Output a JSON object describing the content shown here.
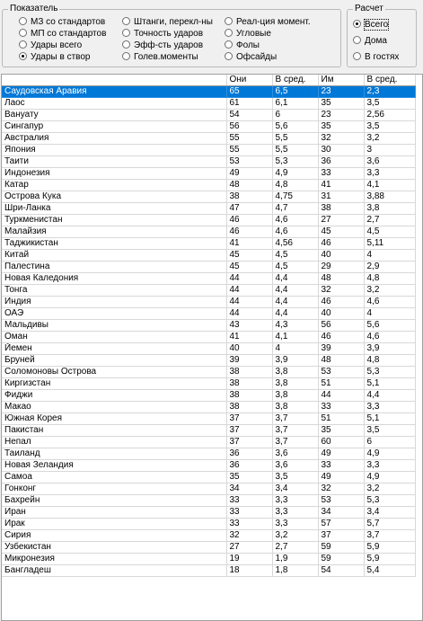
{
  "indicator": {
    "legend": "Показатель",
    "options": [
      {
        "label": "МЗ со стандартов",
        "checked": false
      },
      {
        "label": "МП со стандартов",
        "checked": false
      },
      {
        "label": "Удары всего",
        "checked": false
      },
      {
        "label": "Удары в створ",
        "checked": true
      },
      {
        "label": "Штанги, перекл-ны",
        "checked": false
      },
      {
        "label": "Точность ударов",
        "checked": false
      },
      {
        "label": "Эфф-сть ударов",
        "checked": false
      },
      {
        "label": "Голев.моменты",
        "checked": false
      },
      {
        "label": "Реал-ция момент.",
        "checked": false
      },
      {
        "label": "Угловые",
        "checked": false
      },
      {
        "label": "Фолы",
        "checked": false
      },
      {
        "label": "Офсайды",
        "checked": false
      }
    ]
  },
  "calc": {
    "legend": "Расчет",
    "options": [
      {
        "label": "Всего",
        "checked": true
      },
      {
        "label": "Дома",
        "checked": false
      },
      {
        "label": "В гостях",
        "checked": false
      }
    ]
  },
  "table": {
    "columns": [
      "",
      "Они",
      "В сред.",
      "Им",
      "В сред."
    ],
    "selected_row": 0,
    "rows": [
      [
        "Саудовская Аравия",
        "65",
        "6,5",
        "23",
        "2,3"
      ],
      [
        "Лаос",
        "61",
        "6,1",
        "35",
        "3,5"
      ],
      [
        "Вануату",
        "54",
        "6",
        "23",
        "2,56"
      ],
      [
        "Сингапур",
        "56",
        "5,6",
        "35",
        "3,5"
      ],
      [
        "Австралия",
        "55",
        "5,5",
        "32",
        "3,2"
      ],
      [
        "Япония",
        "55",
        "5,5",
        "30",
        "3"
      ],
      [
        "Таити",
        "53",
        "5,3",
        "36",
        "3,6"
      ],
      [
        "Индонезия",
        "49",
        "4,9",
        "33",
        "3,3"
      ],
      [
        "Катар",
        "48",
        "4,8",
        "41",
        "4,1"
      ],
      [
        "Острова Кука",
        "38",
        "4,75",
        "31",
        "3,88"
      ],
      [
        "Шри-Ланка",
        "47",
        "4,7",
        "38",
        "3,8"
      ],
      [
        "Туркменистан",
        "46",
        "4,6",
        "27",
        "2,7"
      ],
      [
        "Малайзия",
        "46",
        "4,6",
        "45",
        "4,5"
      ],
      [
        "Таджикистан",
        "41",
        "4,56",
        "46",
        "5,11"
      ],
      [
        "Китай",
        "45",
        "4,5",
        "40",
        "4"
      ],
      [
        "Палестина",
        "45",
        "4,5",
        "29",
        "2,9"
      ],
      [
        "Новая Каледония",
        "44",
        "4,4",
        "48",
        "4,8"
      ],
      [
        "Тонга",
        "44",
        "4,4",
        "32",
        "3,2"
      ],
      [
        "Индия",
        "44",
        "4,4",
        "46",
        "4,6"
      ],
      [
        "ОАЭ",
        "44",
        "4,4",
        "40",
        "4"
      ],
      [
        "Мальдивы",
        "43",
        "4,3",
        "56",
        "5,6"
      ],
      [
        "Оман",
        "41",
        "4,1",
        "46",
        "4,6"
      ],
      [
        "Йемен",
        "40",
        "4",
        "39",
        "3,9"
      ],
      [
        "Бруней",
        "39",
        "3,9",
        "48",
        "4,8"
      ],
      [
        "Соломоновы Острова",
        "38",
        "3,8",
        "53",
        "5,3"
      ],
      [
        "Киргизстан",
        "38",
        "3,8",
        "51",
        "5,1"
      ],
      [
        "Фиджи",
        "38",
        "3,8",
        "44",
        "4,4"
      ],
      [
        "Макао",
        "38",
        "3,8",
        "33",
        "3,3"
      ],
      [
        "Южная Корея",
        "37",
        "3,7",
        "51",
        "5,1"
      ],
      [
        "Пакистан",
        "37",
        "3,7",
        "35",
        "3,5"
      ],
      [
        "Непал",
        "37",
        "3,7",
        "60",
        "6"
      ],
      [
        "Таиланд",
        "36",
        "3,6",
        "49",
        "4,9"
      ],
      [
        "Новая Зеландия",
        "36",
        "3,6",
        "33",
        "3,3"
      ],
      [
        "Самоа",
        "35",
        "3,5",
        "49",
        "4,9"
      ],
      [
        "Гонконг",
        "34",
        "3,4",
        "32",
        "3,2"
      ],
      [
        "Бахрейн",
        "33",
        "3,3",
        "53",
        "5,3"
      ],
      [
        "Иран",
        "33",
        "3,3",
        "34",
        "3,4"
      ],
      [
        "Ирак",
        "33",
        "3,3",
        "57",
        "5,7"
      ],
      [
        "Сирия",
        "32",
        "3,2",
        "37",
        "3,7"
      ],
      [
        "Узбекистан",
        "27",
        "2,7",
        "59",
        "5,9"
      ],
      [
        "Микронезия",
        "19",
        "1,9",
        "59",
        "5,9"
      ],
      [
        "Бангладеш",
        "18",
        "1,8",
        "54",
        "5,4"
      ]
    ]
  }
}
